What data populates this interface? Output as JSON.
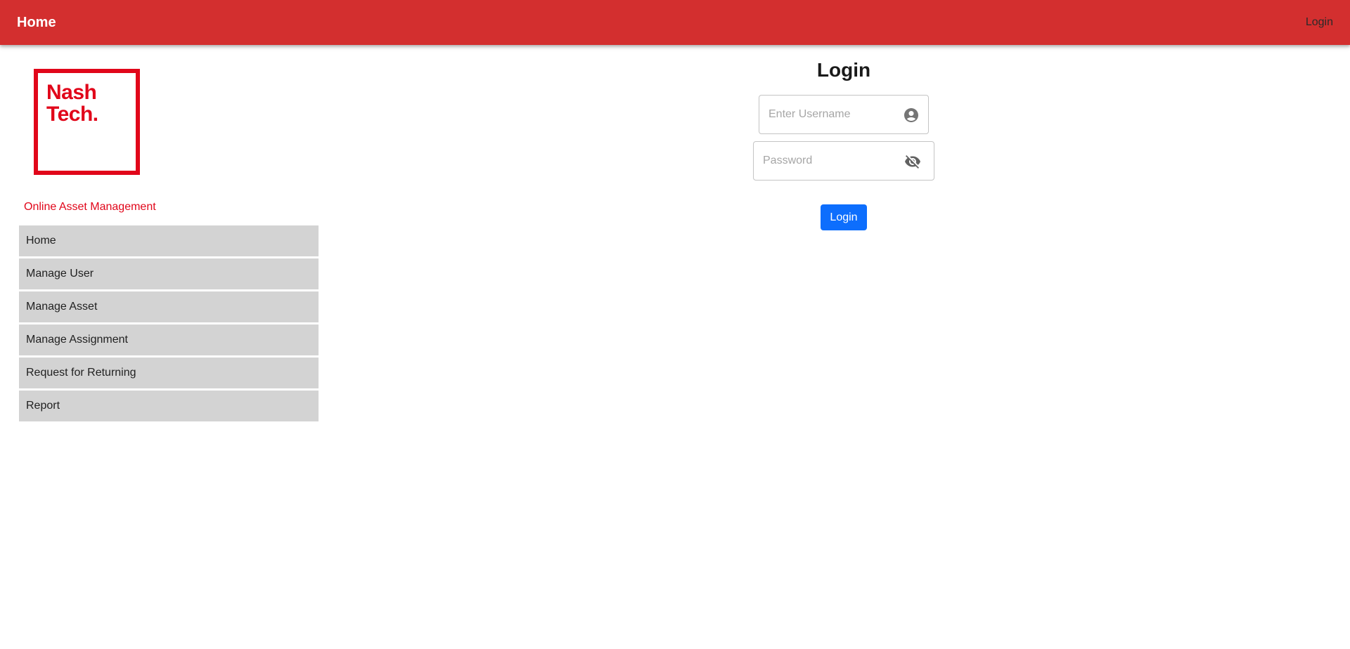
{
  "header": {
    "title": "Home",
    "login_label": "Login"
  },
  "brand": {
    "logo_line1": "Nash",
    "logo_line2": "Tech.",
    "app_name": "Online Asset Management",
    "color": "#e1061a"
  },
  "sidebar": {
    "items": [
      {
        "label": "Home"
      },
      {
        "label": "Manage User"
      },
      {
        "label": "Manage Asset"
      },
      {
        "label": "Manage Assignment"
      },
      {
        "label": "Request for Returning"
      },
      {
        "label": "Report"
      }
    ]
  },
  "login_form": {
    "title": "Login",
    "username": {
      "placeholder": "Enter Username",
      "value": "",
      "icon": "account-circle-icon"
    },
    "password": {
      "placeholder": "Password",
      "value": "",
      "icon": "visibility-off-icon"
    },
    "submit_label": "Login"
  },
  "colors": {
    "app_bar": "#d32f2f",
    "menu_item_bg": "#d3d3d3",
    "primary_button": "#0d6efd"
  }
}
